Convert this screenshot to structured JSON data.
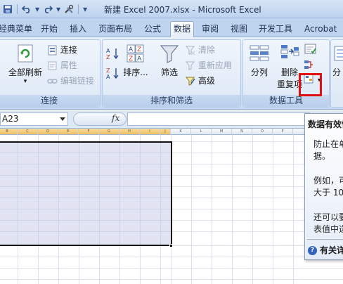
{
  "window": {
    "title": "新建 Excel 2007.xlsx - Microsoft Excel"
  },
  "quick_access": {
    "icons": [
      "save-icon",
      "undo-icon",
      "redo-icon",
      "tools-icon",
      "customize-icon"
    ]
  },
  "tabs": [
    {
      "label": "经典菜单",
      "active": false
    },
    {
      "label": "开始",
      "active": false
    },
    {
      "label": "插入",
      "active": false
    },
    {
      "label": "页面布局",
      "active": false
    },
    {
      "label": "公式",
      "active": false
    },
    {
      "label": "数据",
      "active": true
    },
    {
      "label": "审阅",
      "active": false
    },
    {
      "label": "视图",
      "active": false
    },
    {
      "label": "开发工具",
      "active": false
    },
    {
      "label": "Acrobat",
      "active": false
    }
  ],
  "ribbon": {
    "connections": {
      "label": "连接",
      "refresh_all": "全部刷新",
      "connections": "连接",
      "properties": "属性",
      "edit_links": "编辑链接"
    },
    "sort_filter": {
      "label": "排序和筛选",
      "sort": "排序...",
      "filter": "筛选",
      "clear": "清除",
      "reapply": "重新应用",
      "advanced": "高级"
    },
    "data_tools": {
      "label": "数据工具",
      "text_to_columns": "分列",
      "remove_duplicates_line1": "删除",
      "remove_duplicates_line2": "重复项"
    },
    "outline": {
      "partial_label": "分"
    }
  },
  "formula_bar": {
    "name_box": "A23",
    "fx": "fx",
    "formula": ""
  },
  "sheet": {
    "columns": [
      "A",
      "B",
      "C",
      "D",
      "E",
      "F",
      "G",
      "H",
      "I",
      "J",
      "K",
      "L",
      "M",
      "N",
      "O",
      "P"
    ]
  },
  "tooltip": {
    "title": "数据有效性",
    "lines": [
      "防止在单",
      "据。",
      "例如，可",
      "大于 10",
      "还可以要",
      "表值中选"
    ],
    "help": "有关详"
  },
  "colors": {
    "accent": "#2f62b8",
    "highlight": "#e01010",
    "selection": "#bec4e6"
  }
}
